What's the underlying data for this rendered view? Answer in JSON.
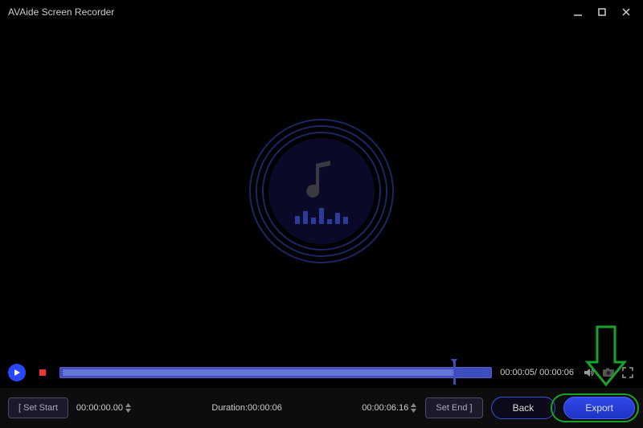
{
  "title": "AVAide Screen Recorder",
  "progress": {
    "current": "00:00:05",
    "total": "00:00:06"
  },
  "trim": {
    "setStartLabel": "[ Set Start",
    "startTime": "00:00:00.00",
    "durationLabel": "Duration:",
    "durationValue": "00:00:06",
    "endTime": "00:00:06.16",
    "setEndLabel": "Set End ]"
  },
  "buttons": {
    "back": "Back",
    "export": "Export"
  }
}
